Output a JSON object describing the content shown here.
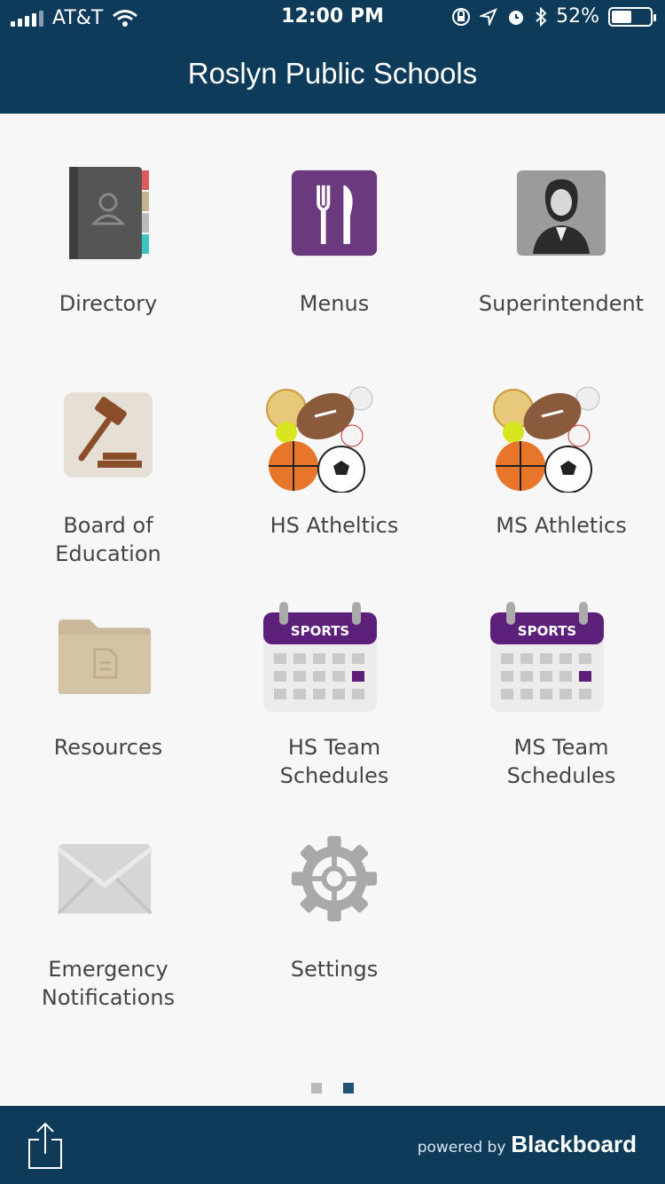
{
  "status_bar": {
    "carrier": "AT&T",
    "time": "12:00 PM",
    "battery": "52%",
    "battery_level": 0.52,
    "icons": [
      "signal-icon",
      "wifi-icon",
      "orientation-lock-icon",
      "location-icon",
      "alarm-icon",
      "bluetooth-icon",
      "battery-icon"
    ]
  },
  "header": {
    "title": "Roslyn Public Schools"
  },
  "tiles": [
    {
      "id": "directory",
      "label": "Directory",
      "icon": "directory-book-icon"
    },
    {
      "id": "menus",
      "label": "Menus",
      "icon": "fork-knife-icon"
    },
    {
      "id": "superintendent",
      "label": "Superintendent",
      "icon": "person-portrait-icon"
    },
    {
      "id": "board",
      "label_line1": "Board of",
      "label_line2": "Education",
      "icon": "gavel-icon"
    },
    {
      "id": "hs-athletics",
      "label": "HS Atheltics",
      "icon": "sports-balls-icon"
    },
    {
      "id": "ms-athletics",
      "label": "MS Athletics",
      "icon": "sports-balls-icon"
    },
    {
      "id": "resources",
      "label": "Resources",
      "icon": "folder-icon"
    },
    {
      "id": "hs-schedules",
      "label_line1": "HS Team",
      "label_line2": "Schedules",
      "icon": "sports-calendar-icon",
      "badge": "SPORTS"
    },
    {
      "id": "ms-schedules",
      "label_line1": "MS Team",
      "label_line2": "Schedules",
      "icon": "sports-calendar-icon",
      "badge": "SPORTS"
    },
    {
      "id": "emergency",
      "label_line1": "Emergency",
      "label_line2": "Notifications",
      "icon": "envelope-icon"
    },
    {
      "id": "settings",
      "label": "Settings",
      "icon": "gear-icon"
    }
  ],
  "pagination": {
    "pages": 2,
    "current": 2
  },
  "footer": {
    "powered_prefix": "powered by",
    "brand": "Blackboard",
    "share_icon": "share-icon"
  },
  "colors": {
    "header": "#0e3b5a",
    "active_dot": "#1f5375",
    "inactive_dot": "#b9b9b9"
  }
}
